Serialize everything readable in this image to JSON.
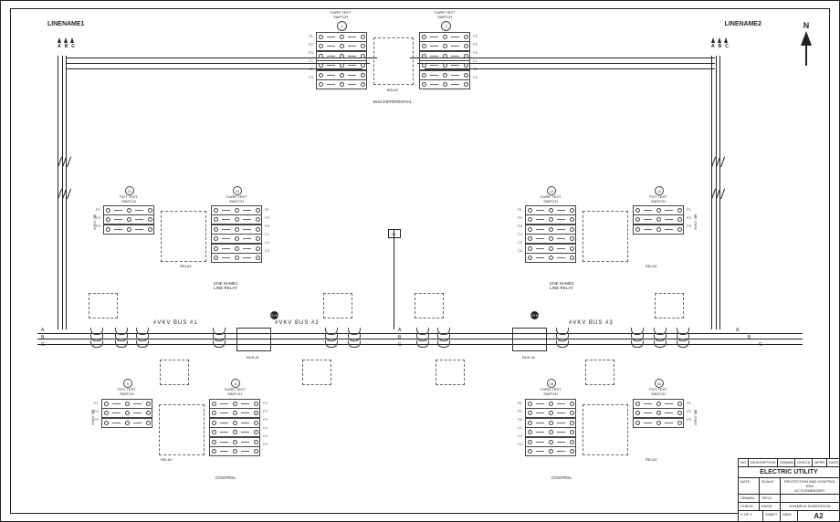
{
  "border": {
    "line1": "LINENAME1",
    "line2": "LINENAME2"
  },
  "phases": [
    "A",
    "B",
    "C"
  ],
  "compass": "N",
  "busbars": [
    {
      "label": "#VKV  BUS  #1"
    },
    {
      "label": "#VKV  BUS  #2"
    },
    {
      "label": "#VKV  BUS  #3"
    }
  ],
  "center": {
    "tag": "V1",
    "sub": "BUS #1",
    "sub2": "BUS #2"
  },
  "top": {
    "switch1_title": "CURR TEST\nSWITCH",
    "switch2_title": "CURR TEST\nSWITCH",
    "relay": "RELAY",
    "caption": "BUS DIFFERENTIAL",
    "bubble1": "2",
    "bubble2": "3"
  },
  "mid": {
    "left": {
      "pot": "POT TEST\nSWITCH",
      "pot_n": "21",
      "cur": "CURR TEST\nSWITCH",
      "cur_n": "22",
      "relay": "RELAY",
      "caption": "LINE NAME1\nLINE RELAY",
      "vert": "#VKV 3Ø"
    },
    "right": {
      "pot": "POT TEST\nSWITCH",
      "pot_n": "11",
      "cur": "CURR TEST\nSWITCH",
      "cur_n": "12",
      "relay": "RELAY",
      "caption": "LINE NAME2\nLINE RELAY",
      "vert": "#VKV 3Ø"
    },
    "syn1": "SYN",
    "syn2": "SYN"
  },
  "low": {
    "left": {
      "pot": "POT TEST\nSWITCH",
      "pot_n": "5",
      "cur": "CURR TEST\nSWITCH",
      "cur_n": "6",
      "relay": "RELAY",
      "caption": "CONTROL",
      "vert": "#VKV 3Ø"
    },
    "right": {
      "pot": "POT TEST\nSWITCH",
      "pot_n": "15",
      "cur": "CURR TEST\nSWITCH",
      "cur_n": "16",
      "relay": "RELAY",
      "caption": "CONTROL",
      "vert": "#VKV 3Ø"
    }
  },
  "strip_rows": [
    "P1",
    "P2",
    "P3",
    "C1",
    "C2",
    "C3"
  ],
  "title_block": {
    "hdr": [
      "NO",
      "DESCRIPTION",
      "DRAWN",
      "CHECK",
      "APPR",
      "DATE"
    ],
    "company": "ELECTRIC UTILITY",
    "rows": [
      [
        "DATE",
        "SCALE",
        "PROTECTION AND CONTROL ENG\nAC ELEMENTARY"
      ],
      [
        "DRAWN",
        "TECH",
        ""
      ],
      [
        "CHECK",
        "ENGR",
        "EXAMPLE SUBSTATION"
      ],
      [
        "X  OF  Y",
        "SHEET",
        "DWG",
        "A2"
      ]
    ]
  }
}
